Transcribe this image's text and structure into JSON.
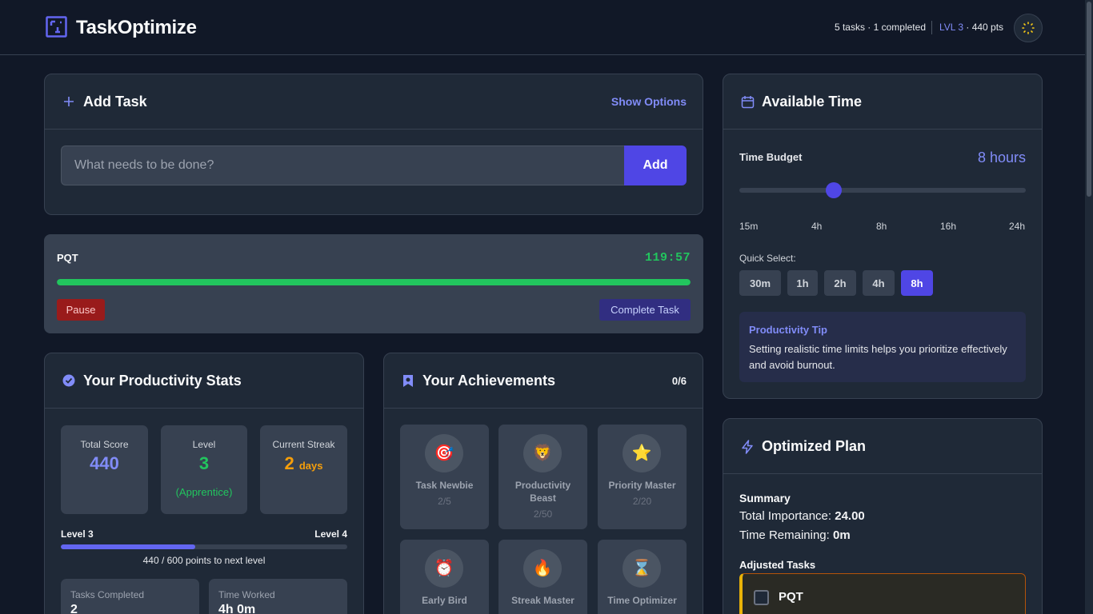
{
  "app": {
    "name": "TaskOptimize",
    "task_summary": "5 tasks · 1 completed",
    "level_label": "LVL 3",
    "points_label": " · 440 pts",
    "accent_color": "#4f46e5"
  },
  "add_task": {
    "title": "Add Task",
    "show_options": "Show Options",
    "placeholder": "What needs to be done?",
    "add_label": "Add"
  },
  "active_timer": {
    "task_name": "PQT",
    "time": "119:57",
    "progress": 1.0,
    "pause_label": "Pause",
    "complete_label": "Complete Task"
  },
  "stats": {
    "title": "Your Productivity Stats",
    "total_score_label": "Total Score",
    "total_score": "440",
    "level_label": "Level",
    "level": "3",
    "level_name": "(Apprentice)",
    "streak_label": "Current Streak",
    "streak": "2",
    "streak_unit": "days",
    "current_level": "Level 3",
    "next_level": "Level 4",
    "level_progress": 0.47,
    "points_to_next": "440 / 600 points to next level",
    "tasks_completed_label": "Tasks Completed",
    "tasks_completed": "2",
    "time_worked_label": "Time Worked",
    "time_worked": "4h 0m"
  },
  "achievements": {
    "title": "Your Achievements",
    "count": "0/6",
    "items": [
      {
        "icon": "🎯",
        "name": "Task Newbie",
        "progress": "2/5"
      },
      {
        "icon": "🦁",
        "name": "Productivity Beast",
        "progress": "2/50"
      },
      {
        "icon": "⭐",
        "name": "Priority Master",
        "progress": "2/20"
      },
      {
        "icon": "⏰",
        "name": "Early Bird",
        "progress": ""
      },
      {
        "icon": "🔥",
        "name": "Streak Master",
        "progress": ""
      },
      {
        "icon": "⌛",
        "name": "Time Optimizer",
        "progress": ""
      }
    ]
  },
  "available_time": {
    "title": "Available Time",
    "budget_label": "Time Budget",
    "budget_value": "8 hours",
    "slider_fraction": 0.33,
    "ticks": [
      "15m",
      "4h",
      "8h",
      "16h",
      "24h"
    ],
    "quick_select_label": "Quick Select:",
    "quick_options": [
      "30m",
      "1h",
      "2h",
      "4h",
      "8h"
    ],
    "quick_selected": "8h",
    "tip_title": "Productivity Tip",
    "tip_text": "Setting realistic time limits helps you prioritize effectively and avoid burnout."
  },
  "plan": {
    "title": "Optimized Plan",
    "summary_title": "Summary",
    "importance_label": "Total Importance:",
    "importance_value": "24.00",
    "remaining_label": "Time Remaining:",
    "remaining_value": "0m",
    "adjusted_title": "Adjusted Tasks",
    "tasks": [
      {
        "name": "PQT"
      }
    ]
  }
}
